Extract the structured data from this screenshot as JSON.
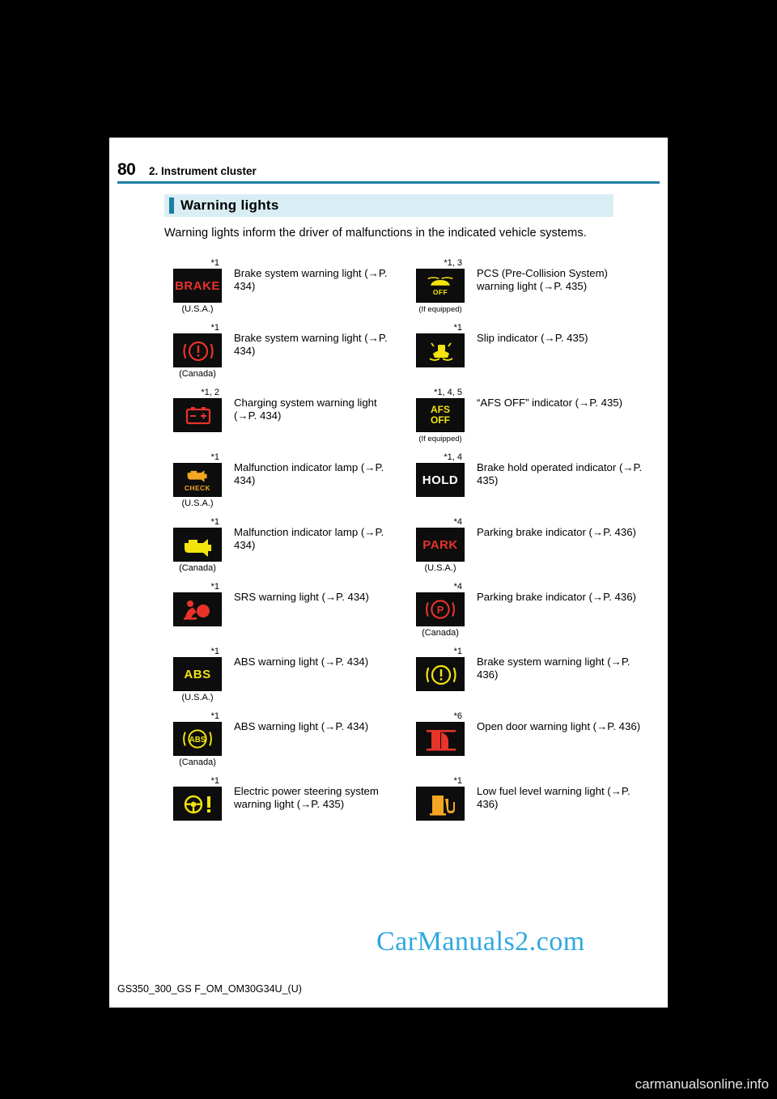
{
  "header": {
    "page_number": "80",
    "chapter_title": "2. Instrument cluster"
  },
  "section": {
    "title": "Warning lights",
    "intro": "Warning lights inform the driver of malfunctions in the indicated vehicle systems."
  },
  "footer": {
    "code": "GS350_300_GS F_OM_OM30G34U_(U)",
    "watermark": "CarManuals2.com",
    "bottom_brand": "carmanualsonline.info"
  },
  "left_column": [
    {
      "footnote": "*1",
      "icon": {
        "type": "text",
        "label": "BRAKE",
        "color": "#e8332a"
      },
      "sublabel": "(U.S.A.)",
      "description": "Brake system warning light (→P. 434)"
    },
    {
      "footnote": "*1",
      "icon": {
        "type": "symbol",
        "label": "(!)",
        "color": "#e8332a"
      },
      "sublabel": "(Canada)",
      "description": "Brake system warning light (→P. 434)"
    },
    {
      "footnote": "*1, 2",
      "icon": {
        "type": "symbol",
        "label": "battery",
        "color": "#e8332a"
      },
      "sublabel": "",
      "description": "Charging system warning light (→P. 434)"
    },
    {
      "footnote": "*1",
      "icon": {
        "type": "symbol",
        "label": "engine-check",
        "color": "#f5a623"
      },
      "sublabel": "(U.S.A.)",
      "description": "Malfunction indicator lamp (→P. 434)"
    },
    {
      "footnote": "*1",
      "icon": {
        "type": "symbol",
        "label": "engine",
        "color": "#f3e40d"
      },
      "sublabel": "(Canada)",
      "description": "Malfunction indicator lamp (→P. 434)"
    },
    {
      "footnote": "*1",
      "icon": {
        "type": "symbol",
        "label": "srs-airbag",
        "color": "#e8332a"
      },
      "sublabel": "",
      "description": "SRS warning light (→P. 434)"
    },
    {
      "footnote": "*1",
      "icon": {
        "type": "text",
        "label": "ABS",
        "color": "#f3e40d"
      },
      "sublabel": "(U.S.A.)",
      "description": "ABS warning light (→P. 434)"
    },
    {
      "footnote": "*1",
      "icon": {
        "type": "symbol",
        "label": "abs-circle",
        "color": "#f3e40d"
      },
      "sublabel": "(Canada)",
      "description": "ABS warning light (→P. 434)"
    },
    {
      "footnote": "*1",
      "icon": {
        "type": "symbol",
        "label": "steering-wheel-alert",
        "color": "#f3e40d"
      },
      "sublabel": "",
      "description": "Electric power steering system warning light (→P. 435)"
    }
  ],
  "right_column": [
    {
      "footnote": "*1, 3",
      "icon": {
        "type": "symbol",
        "label": "pcs-off",
        "color": "#f3e40d"
      },
      "sublabel": "(If equipped)",
      "description": "PCS (Pre-Collision System) warning light (→P. 435)"
    },
    {
      "footnote": "*1",
      "icon": {
        "type": "symbol",
        "label": "slip-indicator",
        "color": "#f3e40d"
      },
      "sublabel": "",
      "description": "Slip indicator (→P. 435)"
    },
    {
      "footnote": "*1, 4, 5",
      "icon": {
        "type": "text2",
        "label": "AFS OFF",
        "color": "#f3e40d"
      },
      "sublabel": "(If equipped)",
      "description": "“AFS OFF” indicator (→P. 435)"
    },
    {
      "footnote": "*1, 4",
      "icon": {
        "type": "text",
        "label": "HOLD",
        "color": "#ffffff"
      },
      "sublabel": "",
      "description": "Brake hold operated indicator (→P. 435)"
    },
    {
      "footnote": "*4",
      "icon": {
        "type": "text",
        "label": "PARK",
        "color": "#e8332a"
      },
      "sublabel": "(U.S.A.)",
      "description": "Parking brake indicator (→P. 436)"
    },
    {
      "footnote": "*4",
      "icon": {
        "type": "symbol",
        "label": "park-p-circle",
        "color": "#e8332a"
      },
      "sublabel": "(Canada)",
      "description": "Parking brake indicator (→P. 436)"
    },
    {
      "footnote": "*1",
      "icon": {
        "type": "symbol",
        "label": "(!)",
        "color": "#f3e40d"
      },
      "sublabel": "",
      "description": "Brake system warning light (→P. 436)"
    },
    {
      "footnote": "*6",
      "icon": {
        "type": "symbol",
        "label": "open-door",
        "color": "#e8332a"
      },
      "sublabel": "",
      "description": "Open door warning light (→P. 436)"
    },
    {
      "footnote": "*1",
      "icon": {
        "type": "symbol",
        "label": "fuel-pump",
        "color": "#f5a623"
      },
      "sublabel": "",
      "description": "Low fuel level warning light (→P. 436)"
    }
  ]
}
